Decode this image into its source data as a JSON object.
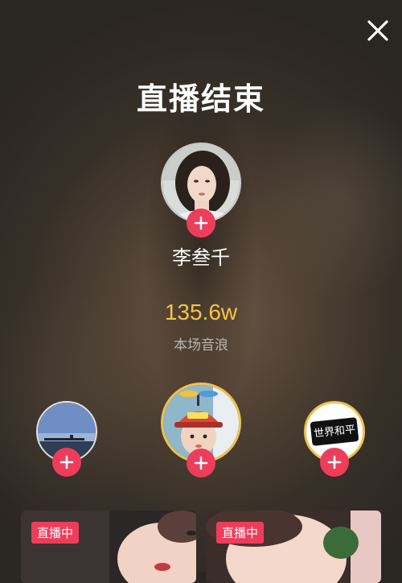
{
  "header": {
    "title": "直播结束",
    "close_icon": "close-icon"
  },
  "host": {
    "name": "李叁千",
    "follow_icon": "plus-icon"
  },
  "stats": {
    "sound_waves": "135.6w",
    "sound_waves_label": "本场音浪"
  },
  "contributors": [
    {
      "avatar": "seaside-landscape-avatar",
      "follow_icon": "plus-icon"
    },
    {
      "avatar": "child-with-propeller-hat-avatar",
      "follow_icon": "plus-icon"
    },
    {
      "avatar": "world-peace-calligraphy-avatar",
      "avatar_text": "世界和平",
      "follow_icon": "plus-icon"
    }
  ],
  "recommended": [
    {
      "badge": "直播中"
    },
    {
      "badge": "直播中"
    }
  ],
  "colors": {
    "accent": "#ee3d5a",
    "gold": "#f5c443",
    "avatar_ring_gold": "#f0c24a"
  }
}
